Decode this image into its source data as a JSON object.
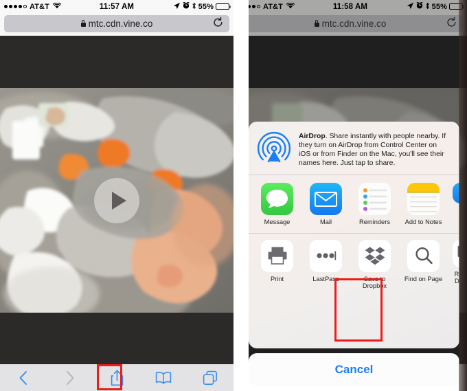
{
  "phones": [
    {
      "id": "left",
      "status_bar": {
        "signal_dots": [
          true,
          true,
          true,
          true,
          false
        ],
        "carrier": "AT&T",
        "wifi_icon": "wifi-icon",
        "time": "11:57 AM",
        "location_icon": "location-arrow-icon",
        "alarm_icon": "alarm-clock-icon",
        "bluetooth_icon": "bluetooth-icon",
        "battery_percent": "55%",
        "battery_level": 55
      },
      "browser": {
        "url": "mtc.cdn.vine.co",
        "lock_icon": "lock-icon",
        "reload_icon": "reload-icon"
      },
      "content": {
        "type": "video-player",
        "play_icon": "play-button-icon",
        "description": "Video of inflatable goose decoys with orange beaks"
      },
      "toolbar": {
        "items": [
          {
            "name": "back-button",
            "icon": "chevron-left-icon",
            "enabled": true
          },
          {
            "name": "forward-button",
            "icon": "chevron-right-icon",
            "enabled": false
          },
          {
            "name": "share-button",
            "icon": "share-up-arrow-icon",
            "enabled": true,
            "highlighted": true
          },
          {
            "name": "bookmarks-button",
            "icon": "book-icon",
            "enabled": true
          },
          {
            "name": "tabs-button",
            "icon": "tabs-squares-icon",
            "enabled": true
          }
        ]
      }
    },
    {
      "id": "right",
      "status_bar": {
        "signal_dots": [
          true,
          true,
          true,
          true,
          false
        ],
        "carrier": "AT&T",
        "wifi_icon": "wifi-icon",
        "time": "11:58 AM",
        "location_icon": "location-arrow-icon",
        "alarm_icon": "alarm-clock-icon",
        "bluetooth_icon": "bluetooth-icon",
        "battery_percent": "55%",
        "battery_level": 55
      },
      "browser": {
        "url": "mtc.cdn.vine.co",
        "lock_icon": "lock-icon",
        "reload_icon": "reload-icon"
      },
      "share_sheet": {
        "airdrop": {
          "icon": "airdrop-icon",
          "title": "AirDrop",
          "body": ". Share instantly with people nearby. If they turn on AirDrop from Control Center on iOS or from Finder on the Mac, you'll see their names here. Just tap to share."
        },
        "apps": [
          {
            "label": "Message",
            "icon": "messages-app-icon"
          },
          {
            "label": "Mail",
            "icon": "mail-app-icon"
          },
          {
            "label": "Reminders",
            "icon": "reminders-app-icon"
          },
          {
            "label": "Add to Notes",
            "icon": "notes-app-icon"
          },
          {
            "label": "",
            "icon": "partial-blue-app-icon"
          }
        ],
        "actions": [
          {
            "label": "Print",
            "icon": "printer-icon",
            "highlighted": false
          },
          {
            "label": "LastPass",
            "icon": "lastpass-dots-icon",
            "highlighted": false
          },
          {
            "label": "Save to Dropbox",
            "icon": "dropbox-icon",
            "highlighted": true
          },
          {
            "label": "Find on Page",
            "icon": "magnifier-icon",
            "highlighted": false
          },
          {
            "label": "Request Desktop",
            "icon": "desktop-monitor-icon",
            "highlighted": false
          }
        ],
        "cancel_label": "Cancel"
      }
    }
  ],
  "colors": {
    "accent_blue": "#1b7ff8",
    "highlight_red": "#ef1b17",
    "letterbox": "#2b2a28",
    "toolbar_bg": "#e3e3e5",
    "urlbar_bg": "#c8c8cc"
  }
}
